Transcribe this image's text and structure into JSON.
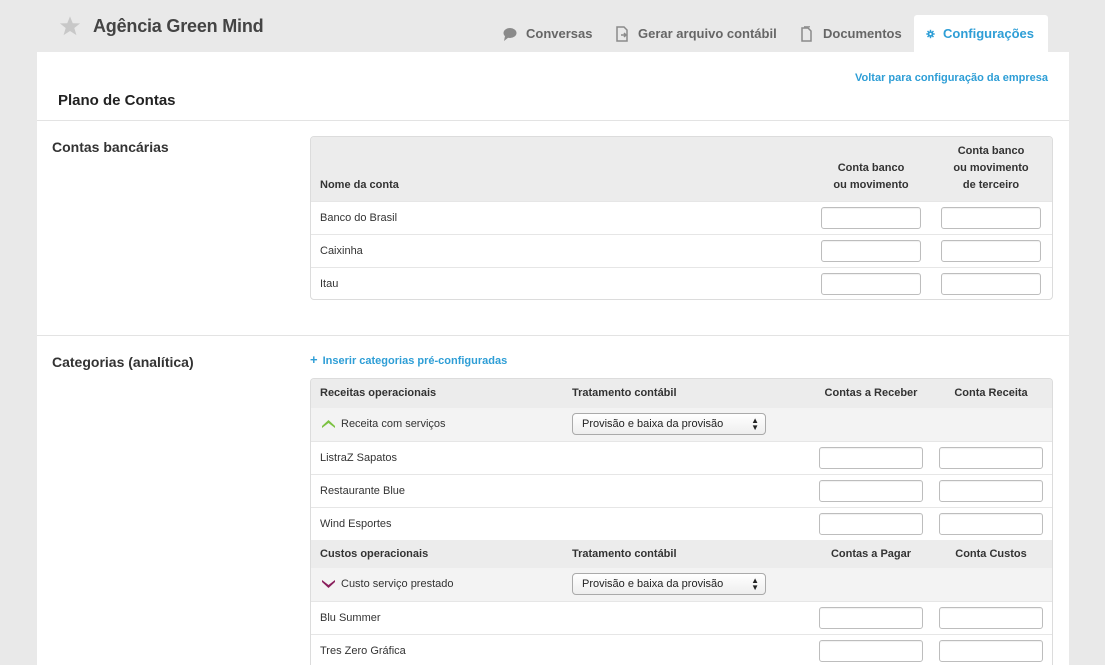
{
  "header": {
    "company_name": "Agência Green Mind",
    "tabs": [
      {
        "label": "Conversas",
        "icon": "chat-icon"
      },
      {
        "label": "Gerar arquivo contábil",
        "icon": "file-export-icon"
      },
      {
        "label": "Documentos",
        "icon": "documents-icon"
      },
      {
        "label": "Configurações",
        "icon": "gear-icon",
        "active": true
      }
    ],
    "accent_color": "#2e9ed6"
  },
  "page": {
    "back_link": "Voltar para configuração da empresa",
    "title": "Plano de Contas"
  },
  "bank_accounts": {
    "section_title": "Contas bancárias",
    "columns": {
      "name": "Nome da conta",
      "col1_line1": "Conta banco",
      "col1_line2": "ou movimento",
      "col2_line1": "Conta banco",
      "col2_line2": "ou movimento",
      "col2_line3": "de terceiro"
    },
    "rows": [
      {
        "name": "Banco do Brasil"
      },
      {
        "name": "Caixinha"
      },
      {
        "name": "Itau"
      }
    ]
  },
  "categories": {
    "section_title": "Categorias (analítica)",
    "insert_link": "Inserir categorias pré-configuradas",
    "groups": [
      {
        "header": "Receitas operacionais",
        "treatment_header": "Tratamento contábil",
        "col1": "Contas a Receber",
        "col2": "Conta Receita",
        "category": "Receita com serviços",
        "category_color": "#7cc242",
        "treatment_value": "Provisão e baixa da provisão",
        "items": [
          "ListraZ Sapatos",
          "Restaurante Blue",
          "Wind Esportes"
        ]
      },
      {
        "header": "Custos operacionais",
        "treatment_header": "Tratamento contábil",
        "col1": "Contas a Pagar",
        "col2": "Conta Custos",
        "category": "Custo serviço prestado",
        "category_color": "#8a1f5c",
        "treatment_value": "Provisão e baixa da provisão",
        "items": [
          "Blu Summer",
          "Tres Zero Gráfica"
        ]
      }
    ]
  }
}
